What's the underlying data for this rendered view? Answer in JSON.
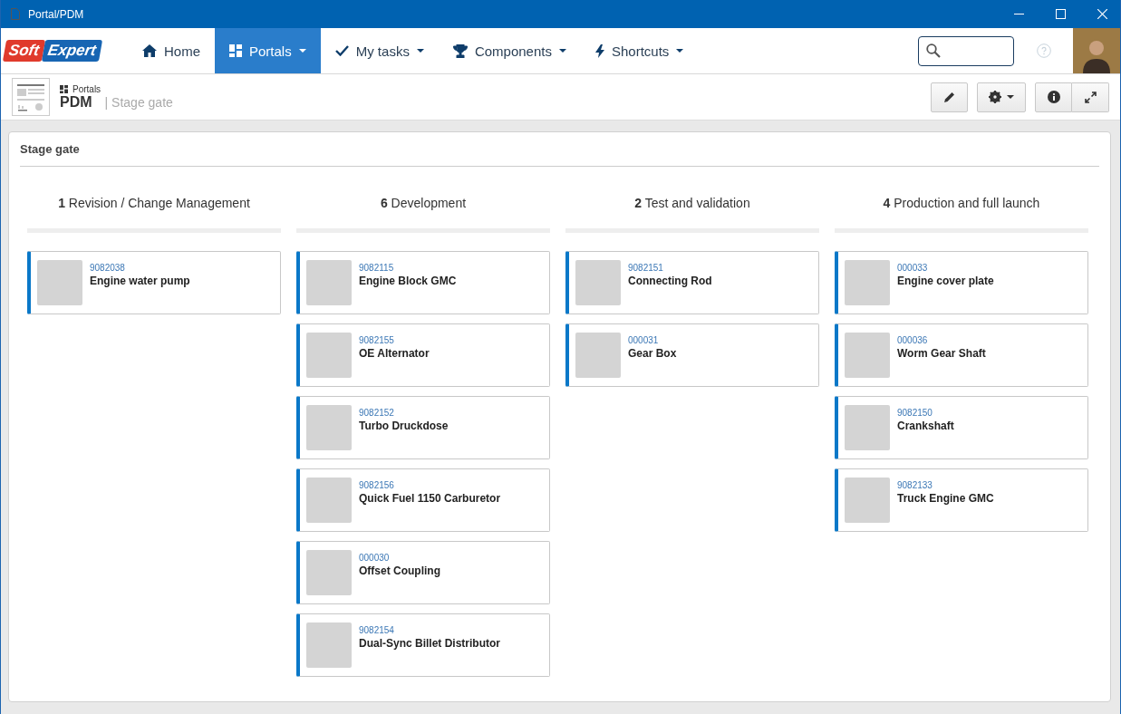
{
  "window": {
    "title": "Portal/PDM"
  },
  "nav": {
    "logo": [
      "Soft",
      "Expert"
    ],
    "items": [
      {
        "label": "Home",
        "dropdown": false,
        "selected": false
      },
      {
        "label": "Portals",
        "dropdown": true,
        "selected": true
      },
      {
        "label": "My tasks",
        "dropdown": true,
        "selected": false
      },
      {
        "label": "Components",
        "dropdown": true,
        "selected": false
      },
      {
        "label": "Shortcuts",
        "dropdown": true,
        "selected": false
      }
    ]
  },
  "header": {
    "breadcrumb": "Portals",
    "title": "PDM",
    "subtitle": "| Stage gate"
  },
  "panel": {
    "title": "Stage gate",
    "columns": [
      {
        "count": "1",
        "name": "Revision / Change Management",
        "cards": [
          {
            "code": "9082038",
            "name": "Engine water pump"
          }
        ]
      },
      {
        "count": "6",
        "name": "Development",
        "cards": [
          {
            "code": "9082115",
            "name": "Engine Block GMC"
          },
          {
            "code": "9082155",
            "name": "OE Alternator"
          },
          {
            "code": "9082152",
            "name": "Turbo Druckdose"
          },
          {
            "code": "9082156",
            "name": "Quick Fuel 1150 Carburetor"
          },
          {
            "code": "000030",
            "name": "Offset Coupling"
          },
          {
            "code": "9082154",
            "name": "Dual-Sync Billet Distributor"
          }
        ]
      },
      {
        "count": "2",
        "name": "Test and validation",
        "cards": [
          {
            "code": "9082151",
            "name": "Connecting Rod"
          },
          {
            "code": "000031",
            "name": "Gear Box"
          }
        ]
      },
      {
        "count": "4",
        "name": "Production and full launch",
        "cards": [
          {
            "code": "000033",
            "name": "Engine cover plate"
          },
          {
            "code": "000036",
            "name": "Worm Gear Shaft"
          },
          {
            "code": "9082150",
            "name": "Crankshaft"
          },
          {
            "code": "9082133",
            "name": "Truck Engine GMC"
          }
        ]
      }
    ]
  }
}
